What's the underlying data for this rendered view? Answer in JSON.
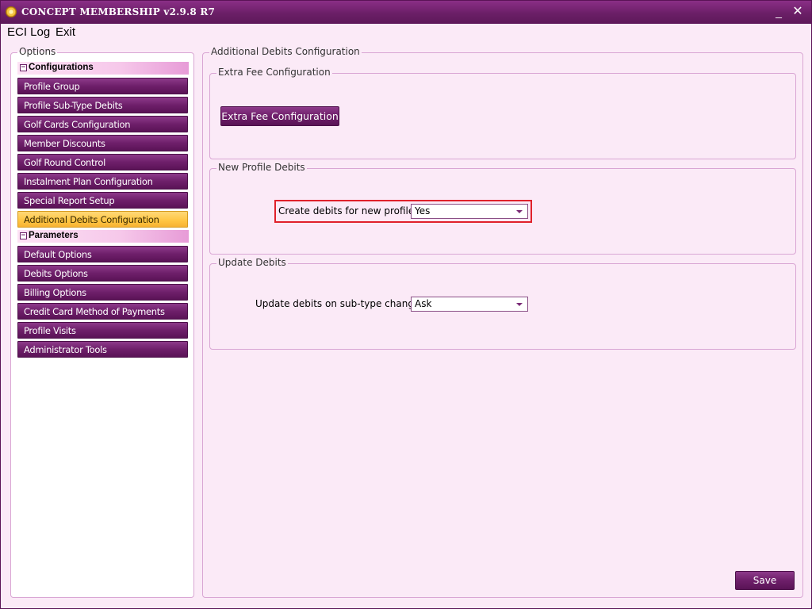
{
  "window": {
    "title": "CONCEPT MEMBERSHIP v2.9.8 R7",
    "minimize": "_",
    "close": "✕"
  },
  "menu": {
    "items": [
      "ECI Log",
      "Exit"
    ]
  },
  "sidebar": {
    "legend": "Options",
    "sections": [
      {
        "label": "Configurations",
        "toggle": "−",
        "items": [
          "Profile Group",
          "Profile Sub-Type Debits",
          "Golf Cards Configuration",
          "Member Discounts",
          "Golf Round Control",
          "Instalment Plan Configuration",
          "Special Report Setup",
          "Additional Debits Configuration"
        ]
      },
      {
        "label": "Parameters",
        "toggle": "−",
        "items": [
          "Default Options",
          "Debits Options",
          "Billing Options",
          "Credit Card Method of Payments",
          "Profile Visits",
          "Administrator Tools"
        ]
      }
    ],
    "active_item": "Additional Debits Configuration"
  },
  "main": {
    "legend": "Additional Debits Configuration",
    "extra_fee": {
      "legend": "Extra Fee Configuration",
      "button_label": "Extra Fee Configuration"
    },
    "new_profile_debits": {
      "legend": "New Profile Debits",
      "field_label": "Create debits for new profiles",
      "value": "Yes"
    },
    "update_debits": {
      "legend": "Update Debits",
      "field_label": "Update debits on sub-type change",
      "value": "Ask"
    },
    "save_label": "Save"
  },
  "colors": {
    "accent": "#6e1f6a",
    "background": "#fbeaf7",
    "active": "#ffc542",
    "highlight": "#e0212b"
  }
}
